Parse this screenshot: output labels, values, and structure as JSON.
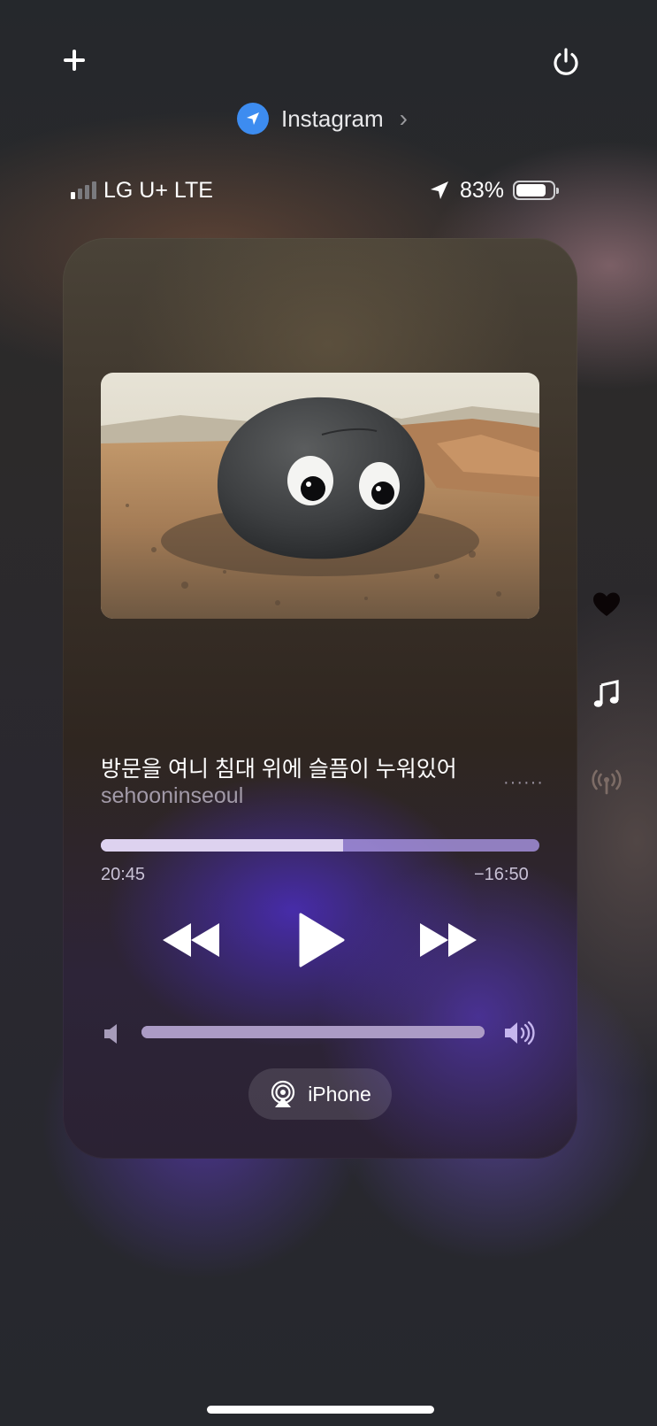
{
  "header": {
    "app_name": "Instagram",
    "chevron": "›",
    "plus_icon": "plus-icon",
    "power_icon": "power-icon"
  },
  "status_bar": {
    "carrier": "LG U+ LTE",
    "signal_bars_on": 1,
    "signal_bars_total": 4,
    "battery_percent": "83%",
    "battery_level": 0.83
  },
  "now_playing": {
    "title": "방문을 여니 침대 위에 슬픔이 누워있어",
    "artist": "sehooninseoul",
    "more_dots": "······",
    "elapsed": "20:45",
    "remaining": "−16:50",
    "progress": 0.553,
    "volume": 1.0,
    "output_device": "iPhone"
  },
  "side_icons": [
    "heart-icon",
    "music-note-icon",
    "broadcast-icon"
  ],
  "colors": {
    "accent_blue": "#3d8cf0",
    "progress_track": "#aa96e6",
    "progress_fill": "#ddd2ef"
  }
}
